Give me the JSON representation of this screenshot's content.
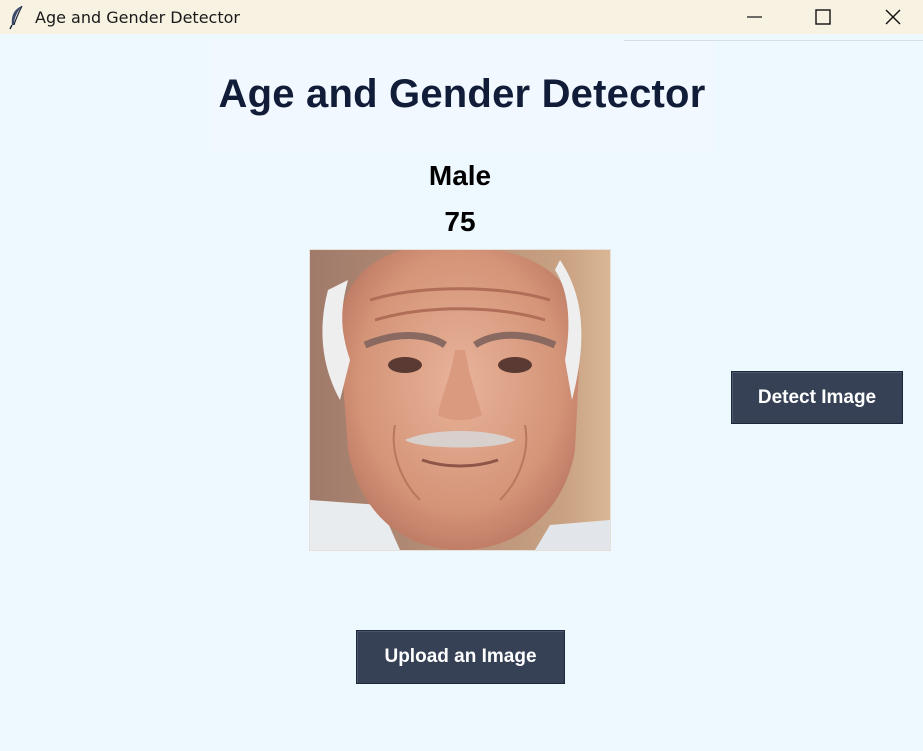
{
  "window": {
    "title": "Age and Gender Detector",
    "icon": "feather-icon",
    "controls": [
      "minimize-icon",
      "maximize-icon",
      "close-icon"
    ]
  },
  "heading": "Age and Gender Detector",
  "result": {
    "gender": "Male",
    "age": "75"
  },
  "buttons": {
    "detect": "Detect Image",
    "upload": "Upload an Image"
  },
  "colors": {
    "background": "#edf9ff",
    "button": "#364156",
    "heading_text": "#101c38",
    "titlebar": "#f7f2e2"
  }
}
